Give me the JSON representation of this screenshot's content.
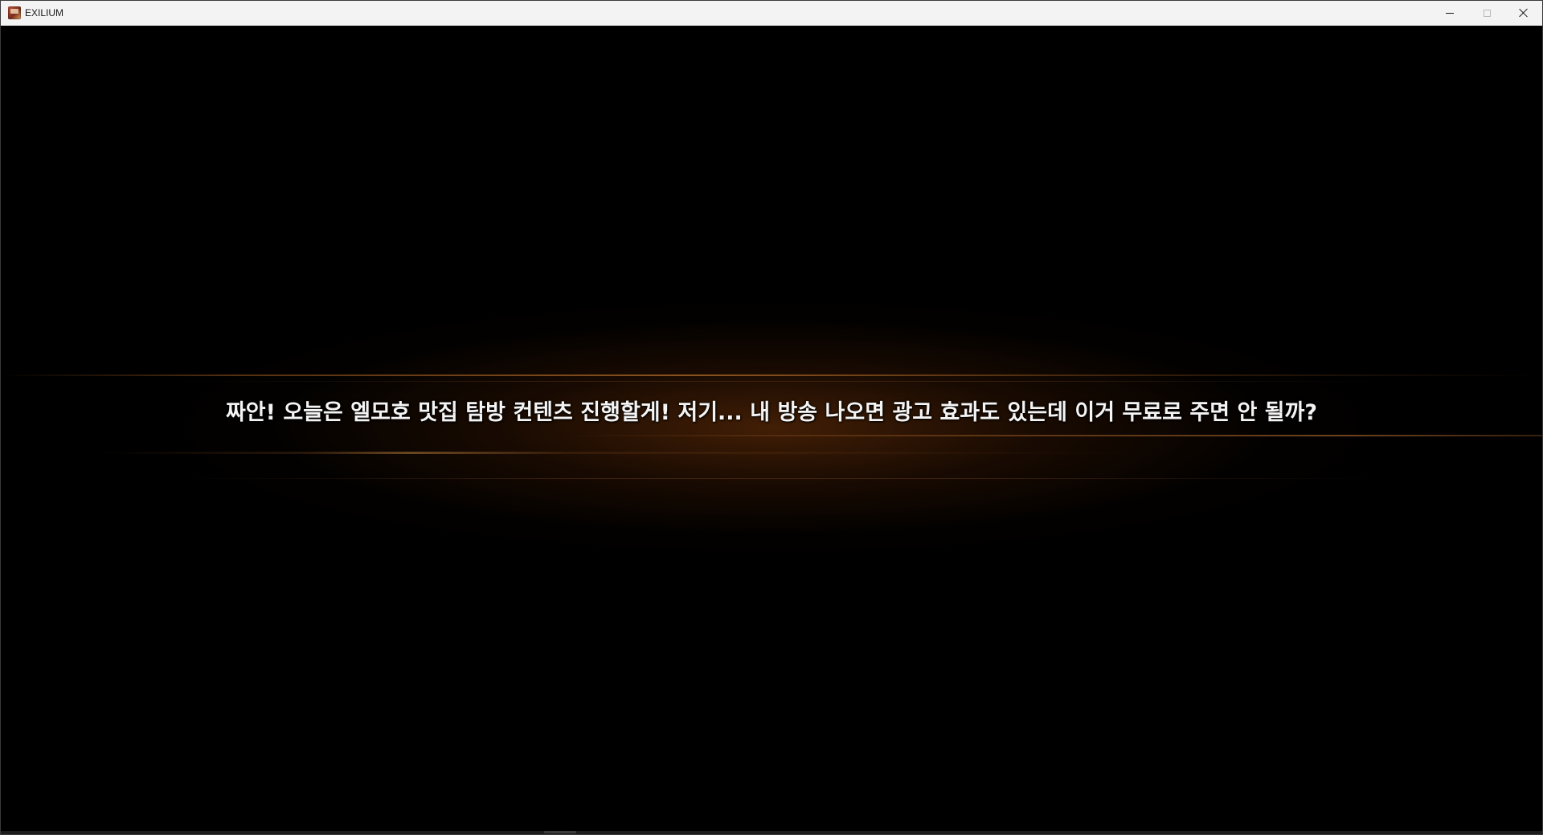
{
  "window": {
    "title": "EXILIUM",
    "icon": "app-icon"
  },
  "controls": {
    "minimize_icon": "minimize-icon",
    "maximize_icon": "maximize-icon",
    "close_icon": "close-icon"
  },
  "scene": {
    "subtitle": "짜안! 오늘은 엘모호 맛집 탐방 컨텐츠 진행할게! 저기... 내 방송 나오면 광고 효과도 있는데 이거 무료로 주면 안 될까?",
    "background_color": "#000000",
    "glow_color": "#7a3a0a"
  }
}
